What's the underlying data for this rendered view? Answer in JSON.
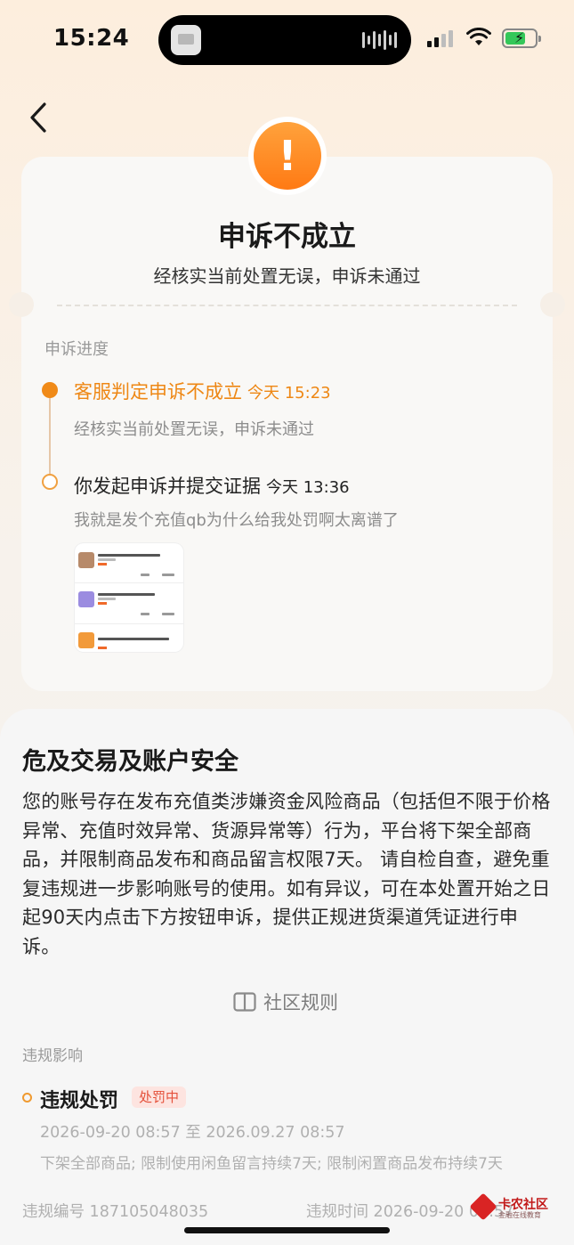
{
  "status_bar": {
    "time": "15:24"
  },
  "card": {
    "title": "申诉不成立",
    "subtitle": "经核实当前处置无误，申诉未通过",
    "progress_label": "申诉进度",
    "steps": [
      {
        "title": "客服判定申诉不成立",
        "time": "今天 15:23",
        "desc": "经核实当前处置无误，申诉未通过"
      },
      {
        "title": "你发起申诉并提交证据",
        "time": "今天 13:36",
        "desc": "我就是发个充值qb为什么给我处罚啊太离谱了"
      }
    ]
  },
  "sheet": {
    "title": "危及交易及账户安全",
    "body": "您的账号存在发布充值类涉嫌资金风险商品（包括但不限于价格异常、充值时效异常、货源异常等）行为，平台将下架全部商品，并限制商品发布和商品留言权限7天。 请自检自查，避免重复违规进一步影响账号的使用。如有异议，可在本处置开始之日起90天内点击下方按钮申诉，提供正规进货渠道凭证进行申诉。",
    "rules_link": "社区规则",
    "impact_label": "违规影响",
    "penalty": {
      "title": "违规处罚",
      "badge": "处罚中",
      "period": "2026-09-20 08:57 至 2026.09.27 08:57",
      "desc": "下架全部商品; 限制使用闲鱼留言持续7天; 限制闲置商品发布持续7天"
    },
    "violation_id": "违规编号 187105048035",
    "violation_time": "违规时间 2026-09-20 08:57"
  },
  "watermark": {
    "text": "卡农社区",
    "sub": "金融在线教育"
  },
  "colors": {
    "accent": "#ee8714",
    "warn": "#ff8a1f",
    "badge_bg": "#fde4e0",
    "badge_text": "#e4503a"
  },
  "icons": [
    "back-chevron-icon",
    "warning-icon",
    "book-icon"
  ]
}
